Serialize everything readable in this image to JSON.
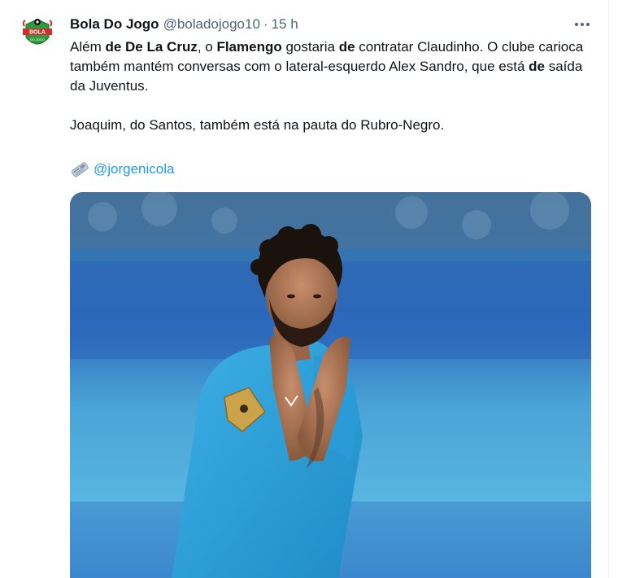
{
  "tweet": {
    "author_name": "Bola Do Jogo",
    "author_handle": "@boladojogo10",
    "separator": "·",
    "time": "15 h",
    "avatar_logo_text": [
      "BOLA",
      "DO JOGO"
    ],
    "paragraph1": [
      {
        "text": "Além ",
        "bold": false
      },
      {
        "text": "de De La Cruz",
        "bold": true
      },
      {
        "text": ", o ",
        "bold": false
      },
      {
        "text": "Flamengo",
        "bold": true
      },
      {
        "text": " gostaria ",
        "bold": false
      },
      {
        "text": "de",
        "bold": true
      },
      {
        "text": " contratar Claudinho. O clube carioca também mantém conversas com o lateral-esquerdo Alex Sandro, que está ",
        "bold": false
      },
      {
        "text": "de",
        "bold": true
      },
      {
        "text": " saída da Juventus.",
        "bold": false
      }
    ],
    "paragraph2": "Joaquim, do Santos, também está na pauta do Rubro-Negro.",
    "credit_handle": "@jorgenicola",
    "media_icon": "newspaper-icon"
  },
  "colors": {
    "link": "#1d9bf0",
    "secondary_text": "#536471",
    "primary_text": "#0f1419",
    "jersey": "#2f9fd6"
  }
}
